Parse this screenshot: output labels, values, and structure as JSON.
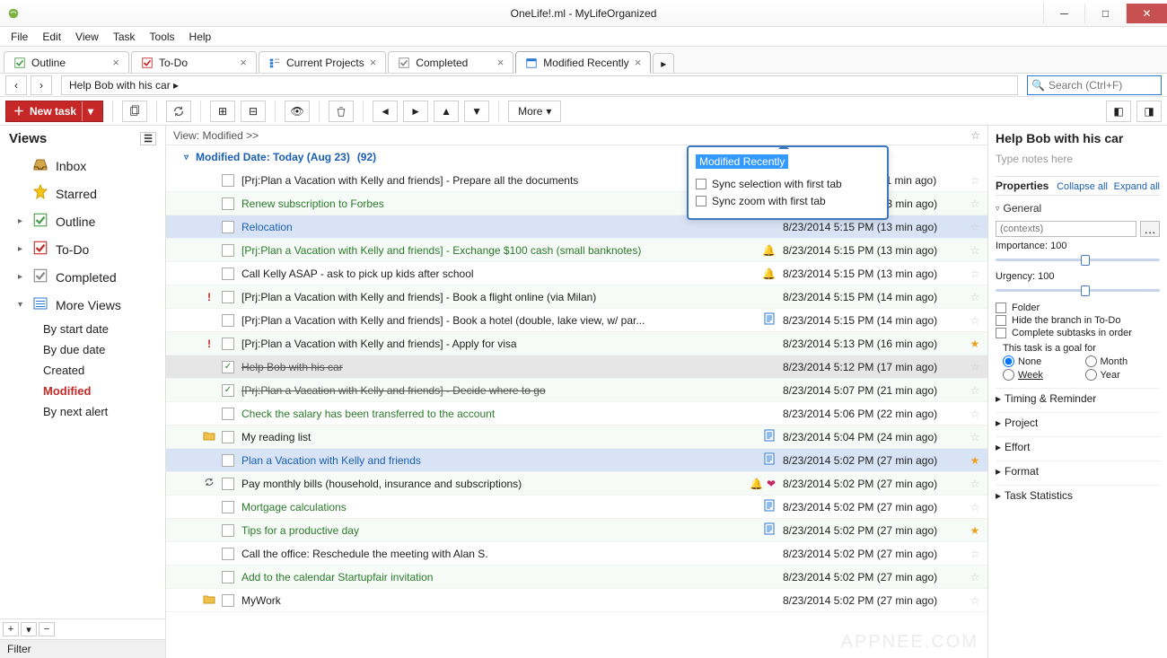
{
  "window": {
    "title": "OneLife!.ml - MyLifeOrganized"
  },
  "menu": [
    "File",
    "Edit",
    "View",
    "Task",
    "Tools",
    "Help"
  ],
  "tabs": [
    {
      "label": "Outline",
      "icon": "outline"
    },
    {
      "label": "To-Do",
      "icon": "todo"
    },
    {
      "label": "Current Projects",
      "icon": "projects"
    },
    {
      "label": "Completed",
      "icon": "completed"
    },
    {
      "label": "Modified Recently",
      "icon": "modified",
      "active": true
    }
  ],
  "breadcrumb": "Help Bob with his car  ▸",
  "search_placeholder": "Search (Ctrl+F)",
  "toolbar": {
    "newtask": "New task",
    "more": "More"
  },
  "sidebar": {
    "title": "Views",
    "views": [
      {
        "label": "Inbox",
        "icon": "inbox"
      },
      {
        "label": "Starred",
        "icon": "star"
      },
      {
        "label": "Outline",
        "icon": "outline",
        "tri": true
      },
      {
        "label": "To-Do",
        "icon": "todo",
        "tri": true
      },
      {
        "label": "Completed",
        "icon": "completed",
        "tri": true
      },
      {
        "label": "More Views",
        "icon": "more",
        "tri": true,
        "open": true
      }
    ],
    "subviews": [
      {
        "label": "By start date"
      },
      {
        "label": "By due date"
      },
      {
        "label": "Created"
      },
      {
        "label": "Modified",
        "active": true
      },
      {
        "label": "By next alert"
      }
    ],
    "filter": "Filter"
  },
  "list": {
    "header": "View: Modified >>",
    "group": "Modified Date: Today (Aug 23)",
    "group_count": "(92)",
    "rows": [
      {
        "title": "[Prj:Plan a Vacation with Kelly and friends] - Prepare all the documents",
        "date": "8/23/2014 5:18 PM (11 min ago)"
      },
      {
        "title": "Renew subscription to Forbes",
        "cls": "green",
        "date": "8/23/2014 5:15 PM (13 min ago)",
        "note": true,
        "alt": true
      },
      {
        "title": "Relocation",
        "cls": "link",
        "bluebg": true,
        "date": "8/23/2014 5:15 PM (13 min ago)"
      },
      {
        "title": "[Prj:Plan a Vacation with Kelly and friends] - Exchange $100 cash (small banknotes)",
        "cls": "green",
        "date": "8/23/2014 5:15 PM (13 min ago)",
        "bell": true,
        "alt": true
      },
      {
        "title": "Call Kelly ASAP - ask to pick up kids after school",
        "cls": "hl",
        "date": "8/23/2014 5:15 PM (13 min ago)",
        "bell": true
      },
      {
        "title": "[Prj:Plan a Vacation with Kelly and friends] - Book a flight online (via Milan)",
        "date": "8/23/2014 5:15 PM (14 min ago)",
        "ex": true,
        "alt": true
      },
      {
        "title": "[Prj:Plan a Vacation with Kelly and friends] - Book a hotel (double, lake view, w/ par...",
        "date": "8/23/2014 5:15 PM (14 min ago)",
        "note": true
      },
      {
        "title": "[Prj:Plan a Vacation with Kelly and friends] - Apply for visa",
        "date": "8/23/2014 5:13 PM (16 min ago)",
        "ex": true,
        "star": true,
        "alt": true
      },
      {
        "title": "Help Bob with his car",
        "cls": "done",
        "checked": true,
        "selected": true,
        "date": "8/23/2014 5:12 PM (17 min ago)"
      },
      {
        "title": "[Prj:Plan a Vacation with Kelly and friends] - Decide where to go",
        "cls": "done",
        "checked": true,
        "green": true,
        "date": "8/23/2014 5:07 PM (21 min ago)",
        "alt": true
      },
      {
        "title": "Check the salary has been transferred to the account",
        "cls": "green",
        "date": "8/23/2014 5:06 PM (22 min ago)"
      },
      {
        "title": "My reading list",
        "folder": true,
        "date": "8/23/2014 5:04 PM (24 min ago)",
        "note": true,
        "alt": true
      },
      {
        "title": "Plan a Vacation with Kelly and friends",
        "cls": "link",
        "bluebg": true,
        "date": "8/23/2014 5:02 PM (27 min ago)",
        "note": true,
        "star": true
      },
      {
        "title": "Pay monthly bills (household, insurance and subscriptions)",
        "recur": true,
        "date": "8/23/2014 5:02 PM (27 min ago)",
        "bell": true,
        "heart": true,
        "alt": true
      },
      {
        "title": "Mortgage calculations",
        "cls": "green",
        "date": "8/23/2014 5:02 PM (27 min ago)",
        "note": true
      },
      {
        "title": "Tips for a productive day",
        "cls": "green",
        "date": "8/23/2014 5:02 PM (27 min ago)",
        "note": true,
        "star": true,
        "alt": true
      },
      {
        "title": "Call the office: Reschedule the meeting with Alan S.",
        "date": "8/23/2014 5:02 PM (27 min ago)"
      },
      {
        "title": "Add to the calendar Startupfair invitation",
        "cls": "green",
        "date": "8/23/2014 5:02 PM (27 min ago)",
        "alt": true
      },
      {
        "title": "MyWork",
        "folder": true,
        "date": "8/23/2014 5:02 PM (27 min ago)"
      }
    ]
  },
  "popup": {
    "title": "Modified Recently",
    "opts": [
      "Sync selection with first tab",
      "Sync zoom with first tab"
    ]
  },
  "props": {
    "title": "Help Bob with his car",
    "notes_ph": "Type notes here",
    "hdr": "Properties",
    "collapse": "Collapse all",
    "expand": "Expand all",
    "general": "General",
    "contexts_ph": "(contexts)",
    "importance_lbl": "Importance:",
    "importance_val": "100",
    "urgency_lbl": "Urgency:",
    "urgency_val": "100",
    "chk_folder": "Folder",
    "chk_hide": "Hide the branch in To-Do",
    "chk_order": "Complete subtasks in order",
    "goal_lbl": "This task is a goal for",
    "goal_opts": [
      "None",
      "Month",
      "Week",
      "Year"
    ],
    "sections": [
      "Timing & Reminder",
      "Project",
      "Effort",
      "Format",
      "Task Statistics"
    ]
  },
  "watermark": "APPNEE.COM"
}
